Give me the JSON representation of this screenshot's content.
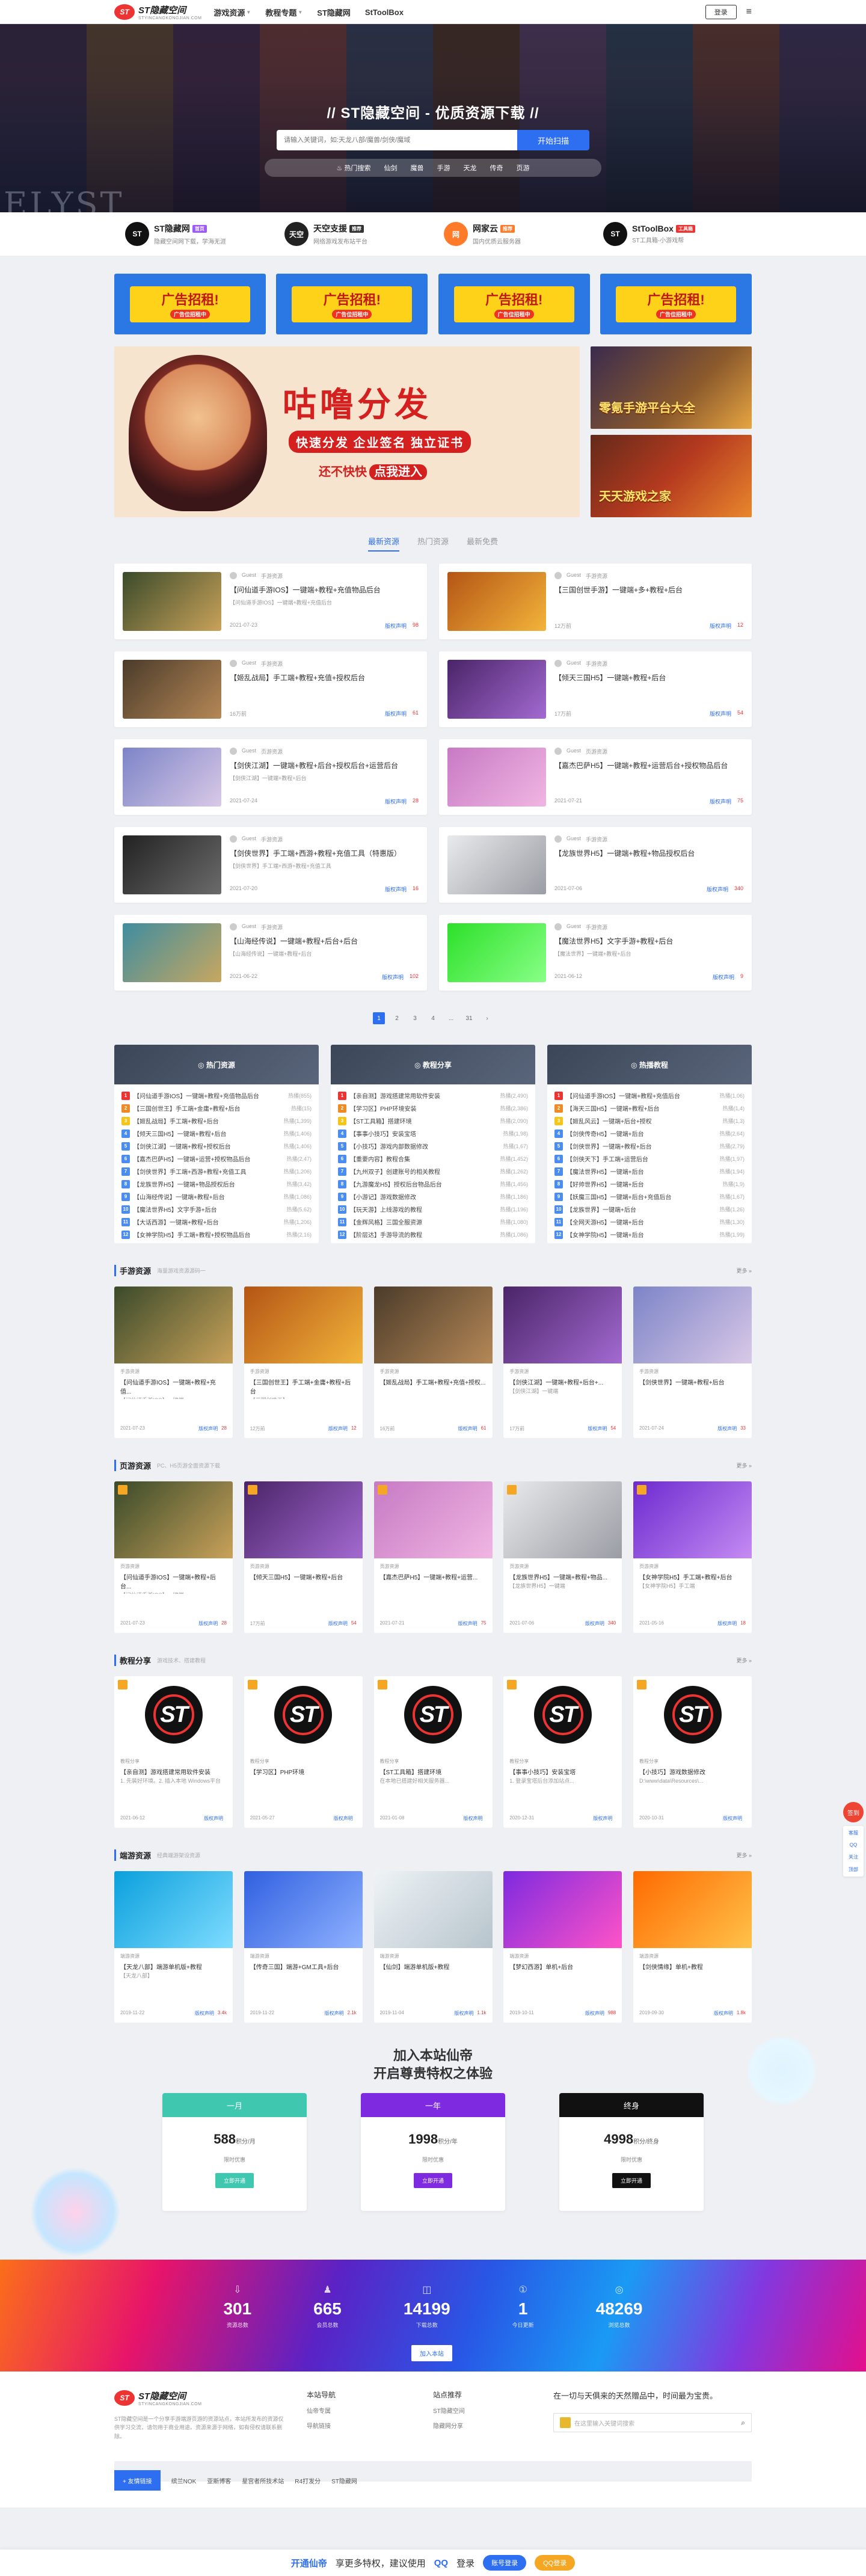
{
  "header": {
    "logo_mark": "ST",
    "logo_text": "ST隐藏空间",
    "logo_sub": "STYINCANGKONGJIAN.COM",
    "nav": [
      "游戏资源",
      "教程专题",
      "ST隐藏网",
      "StToolBox"
    ],
    "login": "登录"
  },
  "hero": {
    "title": "// ST隐藏空间 - 优质资源下载 //",
    "search_placeholder": "请输入关键词，如:天龙八部/魔兽/剑侠/魔域",
    "search_button": "开始扫描",
    "tags": [
      "热门搜索",
      "仙剑",
      "魔兽",
      "手游",
      "天龙",
      "传奇",
      "页游"
    ],
    "watermark": "ELYST"
  },
  "partners": [
    {
      "icon": "ST",
      "name": "ST隐藏网",
      "badge": "首页",
      "desc": "隐藏空间网下载，学海无涯",
      "color": "#111",
      "badge_color": "#9b59ff"
    },
    {
      "icon": "天空",
      "name": "天空支援",
      "badge": "推荐",
      "desc": "网络游戏发布站平台",
      "color": "#222",
      "badge_color": "#333"
    },
    {
      "icon": "网",
      "name": "网家云",
      "badge": "推荐",
      "desc": "国内优质云服务器",
      "color": "#ff7a29",
      "badge_color": "#ff7a29"
    },
    {
      "icon": "ST",
      "name": "StToolBox",
      "badge": "工具箱",
      "desc": "ST工具箱-小游戏帮",
      "color": "#111",
      "badge_color": "#e33"
    }
  ],
  "ads": {
    "small": [
      "广告招租!",
      "广告招租!",
      "广告招租!",
      "广告招租!"
    ],
    "small_sub": "广告位招租中",
    "big_title": "咕噜分发",
    "big_sub": "快速分发 企业签名 独立证书",
    "big_cta_a": "还不快快",
    "big_cta_b": "点我进入",
    "side1": "零氪手游平台大全",
    "side2": "天天游戏之家"
  },
  "tabs": [
    "最新资源",
    "热门资源",
    "最新免费"
  ],
  "posts": [
    {
      "author": "Guest",
      "cat": "手游资源",
      "title": "【问仙道手游IOS】一键端+教程+充值物品后台",
      "desc": "【问仙道手游IOS】一键端+教程+充值后台",
      "date": "2021-07-23",
      "tag": "版权声明",
      "hot": "98",
      "c1": "#3a4a2a",
      "c2": "#c9a25a"
    },
    {
      "author": "Guest",
      "cat": "手游资源",
      "title": "【三国创世手游】一键端+多+教程+后台",
      "desc": "",
      "date": "12万前",
      "tag": "版权声明",
      "hot": "12",
      "c1": "#b45515",
      "c2": "#f2b43a"
    },
    {
      "author": "Guest",
      "cat": "手游资源",
      "title": "【姬乱战局】手工端+教程+充值+授权后台",
      "desc": "",
      "date": "16万前",
      "tag": "版权声明",
      "hot": "61",
      "c1": "#4b3b2a",
      "c2": "#b58856"
    },
    {
      "author": "Guest",
      "cat": "手游资源",
      "title": "【倾天三国H5】一键端+教程+后台",
      "desc": "",
      "date": "17万前",
      "tag": "版权声明",
      "hot": "54",
      "c1": "#4a2468",
      "c2": "#a36ad1"
    },
    {
      "author": "Guest",
      "cat": "页游资源",
      "title": "【剑侠江湖】一键端+教程+后台+授权后台+运营后台",
      "desc": "【剑侠江湖】一键端+教程+后台",
      "date": "2021-07-24",
      "tag": "版权声明",
      "hot": "28",
      "c1": "#7c84c7",
      "c2": "#d9c9e7"
    },
    {
      "author": "Guest",
      "cat": "页游资源",
      "title": "【嘉杰巴萨H5】一键端+教程+运营后台+授权物品后台",
      "desc": "",
      "date": "2021-07-21",
      "tag": "版权声明",
      "hot": "75",
      "c1": "#c77ac4",
      "c2": "#f0b6e2"
    },
    {
      "author": "Guest",
      "cat": "手游资源",
      "title": "【剑侠世界】手工端+西游+教程+充值工具（特惠版）",
      "desc": "【剑侠世界】手工端+西游+教程+充值工具",
      "date": "2021-07-20",
      "tag": "版权声明",
      "hot": "16",
      "c1": "#222",
      "c2": "#6b6b6b"
    },
    {
      "author": "Guest",
      "cat": "手游资源",
      "title": "【龙族世界H5】一键端+教程+物品授权后台",
      "desc": "",
      "date": "2021-07-06",
      "tag": "版权声明",
      "hot": "340",
      "c1": "#e9eaec",
      "c2": "#9a9da4"
    },
    {
      "author": "Guest",
      "cat": "手游资源",
      "title": "【山海经传说】一键端+教程+后台+后台",
      "desc": "【山海经传说】一键端+教程+后台",
      "date": "2021-06-22",
      "tag": "版权声明",
      "hot": "102",
      "c1": "#3f8da0",
      "c2": "#c7a760"
    },
    {
      "author": "Guest",
      "cat": "手游资源",
      "title": "【魔法世界H5】文字手游+教程+后台",
      "desc": "【魔法世界】一键端+教程+后台",
      "date": "2021-06-12",
      "tag": "版权声明",
      "hot": "9",
      "c1": "#2de02a",
      "c2": "#88ff86"
    }
  ],
  "pager": [
    "1",
    "2",
    "3",
    "4",
    "...",
    "31",
    "›"
  ],
  "ranks": [
    {
      "title": "◎ 热门资源",
      "items": [
        [
          "【问仙道手游IOS】一键端+教程+充值物品后台",
          "热播(855)"
        ],
        [
          "【三国创世王】手工端+金庸+教程+后台",
          "热播(15)"
        ],
        [
          "【姬乱战局】手工端+教程+后台",
          "热播(1,399)"
        ],
        [
          "【倾天三国H5】一键端+教程+后台",
          "热播(1,406)"
        ],
        [
          "【剑侠江湖】一键端+教程+授权后台",
          "热播(1,406)"
        ],
        [
          "【嘉杰巴萨H5】一键端+运营+授权物品后台",
          "热播(2,47)"
        ],
        [
          "【剑侠世界】手工端+西游+教程+充值工具",
          "热播(1,206)"
        ],
        [
          "【龙族世界H5】一键端+物品授权后台",
          "热播(3,42)"
        ],
        [
          "【山海经传说】一键端+教程+后台",
          "热播(1,086)"
        ],
        [
          "【魔法世界H5】文字手游+后台",
          "热播(5,62)"
        ],
        [
          "【大话西游】一键端+教程+后台",
          "热播(1,206)"
        ],
        [
          "【女神学院H5】手工端+教程+授权物品后台",
          "热播(2,16)"
        ]
      ]
    },
    {
      "title": "◎ 教程分享",
      "items": [
        [
          "【亲自测】游戏搭建常用软件安装",
          "热播(2,490)"
        ],
        [
          "【学习区】PHP环境安装",
          "热播(2,386)"
        ],
        [
          "【ST工具箱】搭建环境",
          "热播(2,090)"
        ],
        [
          "【事事小技巧】安装宝塔",
          "热播(1,98)"
        ],
        [
          "【小技巧】游戏内部数据修改",
          "热播(1,67)"
        ],
        [
          "【重要内容】教程合集",
          "热播(1,452)"
        ],
        [
          "【九州双子】创建账号的相关教程",
          "热播(1,262)"
        ],
        [
          "【九游魔龙H5】授权后台物品后台",
          "热播(1,456)"
        ],
        [
          "【小游记】游戏数据修改",
          "热播(1,186)"
        ],
        [
          "【玩天游】上线游戏的教程",
          "热播(1,196)"
        ],
        [
          "【金辉风格】三国全服资源",
          "热播(1,080)"
        ],
        [
          "【阶层达】手游导流的教程",
          "热播(1,086)"
        ]
      ]
    },
    {
      "title": "◎ 热播教程",
      "items": [
        [
          "【问仙道手游IOS】一键端+教程+充值后台",
          "热播(1,06)"
        ],
        [
          "【海天三国H5】一键端+教程+后台",
          "热播(1,4)"
        ],
        [
          "【姬乱风云】一键端+后台+授权",
          "热播(1,3)"
        ],
        [
          "【剑侠传奇H5】一键端+后台",
          "热播(2,64)"
        ],
        [
          "【剑侠世界】一键端+教程+后台",
          "热播(2,79)"
        ],
        [
          "【剑侠天下】手工端+运营后台",
          "热播(1,97)"
        ],
        [
          "【魔法世界H5】一键端+后台",
          "热播(1,94)"
        ],
        [
          "【好帅世界H5】一键端+后台",
          "热播(1,9)"
        ],
        [
          "【妖魔三国H5】一键端+后台+充值后台",
          "热播(1,67)"
        ],
        [
          "【龙族世界】一键端+后台",
          "热播(1,26)"
        ],
        [
          "【全网天游H5】一键端+后台",
          "热播(1,30)"
        ],
        [
          "【女神学院H5】一键端+后台",
          "热播(1,99)"
        ]
      ]
    }
  ],
  "sections": [
    {
      "title": "手游资源",
      "desc": "海量游戏资源源码一",
      "more": "更多 »",
      "cards": [
        {
          "cat": "手游资源",
          "title": "【问仙道手游IOS】一键端+教程+充值...",
          "desc": "【问仙道手游IOS】一键端...",
          "date": "2021-07-23",
          "hot": "28",
          "c1": "#3a4a2a",
          "c2": "#c9a25a"
        },
        {
          "cat": "手游资源",
          "title": "【三国创世王】手工端+金庸+教程+后台",
          "desc": "【三国创世王】",
          "date": "12万前",
          "hot": "12",
          "c1": "#b45515",
          "c2": "#f2b43a"
        },
        {
          "cat": "手游资源",
          "title": "【姬乱战局】手工端+教程+充值+授权...",
          "desc": "",
          "date": "16万前",
          "hot": "61",
          "c1": "#4b3b2a",
          "c2": "#b58856"
        },
        {
          "cat": "手游资源",
          "title": "【剑侠江湖】一键端+教程+后台+...",
          "desc": "【剑侠江湖】一键端",
          "date": "17万前",
          "hot": "54",
          "c1": "#4a2468",
          "c2": "#a36ad1"
        },
        {
          "cat": "手游资源",
          "title": "【剑侠世界】一键端+教程+后台",
          "desc": "",
          "date": "2021-07-24",
          "hot": "33",
          "c1": "#7c84c7",
          "c2": "#d9c9e7"
        }
      ]
    },
    {
      "title": "页游资源",
      "desc": "PC、H5页游全面资源下载",
      "more": "更多 »",
      "cards": [
        {
          "cat": "页游资源",
          "title": "【问仙道手游IOS】一键端+教程+后台...",
          "desc": "【问仙道手游IOS】一键端",
          "date": "2021-07-23",
          "hot": "28",
          "c1": "#3a4a2a",
          "c2": "#c9a25a"
        },
        {
          "cat": "页游资源",
          "title": "【倾天三国H5】一键端+教程+后台",
          "desc": "",
          "date": "17万前",
          "hot": "54",
          "c1": "#4a2468",
          "c2": "#a36ad1"
        },
        {
          "cat": "页游资源",
          "title": "【嘉杰巴萨H5】一键端+教程+运营...",
          "desc": "",
          "date": "2021-07-21",
          "hot": "75",
          "c1": "#c77ac4",
          "c2": "#f0b6e2"
        },
        {
          "cat": "页游资源",
          "title": "【龙族世界H5】一键端+教程+物品...",
          "desc": "【龙族世界H5】一键端",
          "date": "2021-07-06",
          "hot": "340",
          "c1": "#e9eaec",
          "c2": "#9a9da4"
        },
        {
          "cat": "页游资源",
          "title": "【女神学院H5】手工端+教程+后台",
          "desc": "【女神学院H5】手工端",
          "date": "2021-05-16",
          "hot": "18",
          "c1": "#6d2ad0",
          "c2": "#c58bf2"
        }
      ]
    },
    {
      "title": "教程分享",
      "desc": "游戏技术、搭建教程",
      "more": "更多 »",
      "st": true,
      "cards": [
        {
          "cat": "教程分享",
          "title": "【亲自测】游戏搭建常用软件安装",
          "desc": "1. 先装好环境。2. 插入本地 Windows平台 ...",
          "date": "2021-06-12",
          "hot": "",
          "c1": "#fff",
          "c2": "#fff"
        },
        {
          "cat": "教程分享",
          "title": "【学习区】PHP环境",
          "desc": "",
          "date": "2021-05-27",
          "hot": "",
          "c1": "#fff",
          "c2": "#fff"
        },
        {
          "cat": "教程分享",
          "title": "【ST工具箱】搭建环境",
          "desc": "在本地已搭建好相关服务器...",
          "date": "2021-01-08",
          "hot": "",
          "c1": "#fff",
          "c2": "#fff"
        },
        {
          "cat": "教程分享",
          "title": "【事事小技巧】安装宝塔",
          "desc": "1. 登录宝塔后台添加站点...",
          "date": "2020-12-31",
          "hot": "",
          "c1": "#fff",
          "c2": "#fff"
        },
        {
          "cat": "教程分享",
          "title": "【小技巧】游戏数据修改",
          "desc": "D:\\www\\data\\Resources\\...",
          "date": "2020-10-31",
          "hot": "",
          "c1": "#fff",
          "c2": "#fff"
        }
      ]
    },
    {
      "title": "端游资源",
      "desc": "经典端游架设资源",
      "more": "更多 »",
      "cards": [
        {
          "cat": "端游资源",
          "title": "【天龙八部】端游单机版+教程",
          "desc": "【天龙八部】",
          "date": "2019-11-22",
          "hot": "3.4k",
          "c1": "#0aa0dc",
          "c2": "#7fdcff"
        },
        {
          "cat": "端游资源",
          "title": "【传奇三国】端游+GM工具+后台",
          "desc": "",
          "date": "2019-11-22",
          "hot": "2.1k",
          "c1": "#3060e0",
          "c2": "#8fb2ff"
        },
        {
          "cat": "端游资源",
          "title": "【仙剑】端游单机版+教程",
          "desc": "",
          "date": "2019-11-04",
          "hot": "1.1k",
          "c1": "#eef3f6",
          "c2": "#b7c4cc"
        },
        {
          "cat": "端游资源",
          "title": "【梦幻西游】单机+后台",
          "desc": "",
          "date": "2019-10-11",
          "hot": "988",
          "c1": "#7d2ae0",
          "c2": "#ff53c7"
        },
        {
          "cat": "端游资源",
          "title": "【剑侠情缘】单机+教程",
          "desc": "",
          "date": "2019-09-30",
          "hot": "1.8k",
          "c1": "#ff6a00",
          "c2": "#ffc24a"
        }
      ]
    }
  ],
  "vip": {
    "title1": "加入本站仙帝",
    "title2": "开启尊贵特权之体验",
    "plans": [
      {
        "name": "一月",
        "price": "588",
        "unit": "积分/月",
        "limit": "限时优惠",
        "btn": "立即开通",
        "head": "#3fc7b0",
        "btn_color": "#3fc7b0"
      },
      {
        "name": "一年",
        "price": "1998",
        "unit": "积分/年",
        "limit": "限时优惠",
        "btn": "立即开通",
        "head": "#7d2ae0",
        "btn_color": "#7d2ae0"
      },
      {
        "name": "终身",
        "price": "4998",
        "unit": "积分/终身",
        "limit": "限时优惠",
        "btn": "立即开通",
        "head": "#111",
        "btn_color": "#111"
      }
    ]
  },
  "stats": {
    "items": [
      {
        "icon": "⇩",
        "value": "301",
        "label": "资源总数"
      },
      {
        "icon": "♟",
        "value": "665",
        "label": "会员总数"
      },
      {
        "icon": "◫",
        "value": "14199",
        "label": "下载总数"
      },
      {
        "icon": "①",
        "value": "1",
        "label": "今日更新"
      },
      {
        "icon": "◎",
        "value": "48269",
        "label": "浏览总数"
      }
    ],
    "join": "加入本站"
  },
  "footer": {
    "about": "ST隐藏空间是一个分享手游端游页游的资源站点，本站所发布的资源仅供学习交流，请勿用于商业用途。资源来源于网络，如有侵权请联系删除。",
    "col1_title": "本站导航",
    "col1_items": [
      "仙帝专属",
      "导航链接"
    ],
    "col2_title": "站点推荐",
    "col2_items": [
      "ST隐藏空间",
      "隐藏网分享"
    ],
    "col3_title": "在一切与天俱来的天然赠品中，时间最为宝贵。",
    "search_placeholder": "在这里输入关键词搜索",
    "links_label": "+ 友情链接",
    "links": [
      "缤兰NOK",
      "亚斯博客",
      "星宫者所技术站",
      "R4打发分",
      "ST隐藏网"
    ]
  },
  "bottom_bar": {
    "a": "开通仙帝",
    "b": "享更多特权，建议使用",
    "c": "QQ",
    "d": "登录",
    "btn1": "账号登录",
    "btn2": "QQ登录"
  },
  "float": {
    "red": "签到",
    "items": [
      "客服",
      "QQ",
      "关注",
      "顶部"
    ]
  }
}
